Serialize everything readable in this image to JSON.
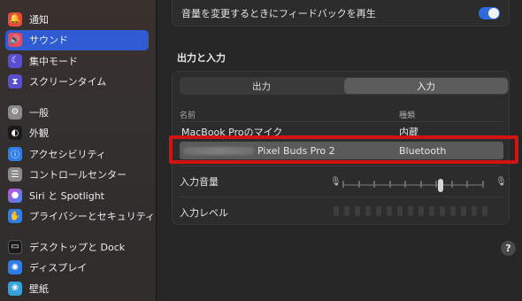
{
  "sidebar": {
    "items": [
      {
        "label": "通知",
        "icon": "bell-icon",
        "color": "#e64b3c",
        "selected": false
      },
      {
        "label": "サウンド",
        "icon": "speaker-icon",
        "color": "#e64b5c",
        "selected": true
      },
      {
        "label": "集中モード",
        "icon": "moon-icon",
        "color": "#5b4fcf",
        "selected": false
      },
      {
        "label": "スクリーンタイム",
        "icon": "hourglass-icon",
        "color": "#5b4fcf",
        "selected": false
      },
      {
        "label": "一般",
        "icon": "gear-icon",
        "color": "#8a8a8a",
        "selected": false
      },
      {
        "label": "外観",
        "icon": "appearance-icon",
        "color": "#1a1a1a",
        "selected": false
      },
      {
        "label": "アクセシビリティ",
        "icon": "accessibility-icon",
        "color": "#2f7ee8",
        "selected": false
      },
      {
        "label": "コントロールセンター",
        "icon": "control-center-icon",
        "color": "#8a8a8a",
        "selected": false
      },
      {
        "label": "Siri と Spotlight",
        "icon": "siri-icon",
        "color": "#3a3a8a",
        "selected": false
      },
      {
        "label": "プライバシーとセキュリティ",
        "icon": "hand-icon",
        "color": "#2f7ee8",
        "selected": false
      },
      {
        "label": "デスクトップと Dock",
        "icon": "dock-icon",
        "color": "#1a1a1a",
        "selected": false
      },
      {
        "label": "ディスプレイ",
        "icon": "display-icon",
        "color": "#2f7ee8",
        "selected": false
      },
      {
        "label": "壁紙",
        "icon": "wallpaper-icon",
        "color": "#35a3d8",
        "selected": false
      }
    ]
  },
  "main": {
    "feedback_label": "音量を変更するときにフィードバックを再生",
    "feedback_enabled": true,
    "section_title": "出力と入力",
    "tabs": [
      {
        "label": "出力",
        "active": false
      },
      {
        "label": "入力",
        "active": true
      }
    ],
    "columns": {
      "name": "名前",
      "type": "種類"
    },
    "devices": [
      {
        "name": "MacBook Proのマイク",
        "type": "内蔵",
        "selected": false
      },
      {
        "name": "Pixel Buds Pro 2",
        "type": "Bluetooth",
        "selected": true
      }
    ],
    "input_volume_label": "入力音量",
    "input_volume_level": 0.7,
    "input_level_label": "入力レベル",
    "input_level_bars": 15,
    "help": "?"
  },
  "colors": {
    "accent": "#2f5bd3",
    "highlight_box": "#d4120f"
  }
}
